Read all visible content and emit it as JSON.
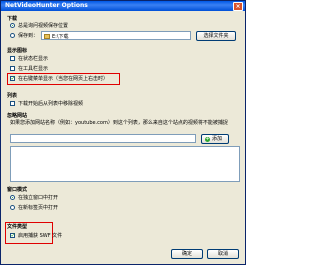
{
  "window": {
    "title": "NetVideoHunter Options",
    "close_glyph": "×"
  },
  "download": {
    "section_title": "下载",
    "ask_radio": "总是询问视频保存位置",
    "save_to_radio": "保存到：",
    "save_path": "E:\\下载",
    "choose_folder_button": "选择文件夹"
  },
  "display_icon": {
    "section_title": "显示图标",
    "option_statusbar": "在状态栏显示",
    "option_toolbar": "在工具栏显示",
    "option_context_menu": "在右键菜单显示（当您在网页上右击时）"
  },
  "list": {
    "section_title": "列表",
    "option_remove_on_download": "下载开始后从列表中移除视频"
  },
  "blocked_sites": {
    "section_title": "忽略网站",
    "description": "如果您添加网站名称（例如：youtube.com）到这个列表，那么来自这个站点的视频将不能被捕捉",
    "input_value": "",
    "add_button": "添加"
  },
  "window_mode": {
    "section_title": "窗口模式",
    "option_new_window": "在独立窗口中打开",
    "option_new_tab": "在新标签页中打开"
  },
  "file_type": {
    "section_title": "文件类型",
    "option_swf": "启用捕获 SWF 文件"
  },
  "footer": {
    "ok_button": "确定",
    "cancel_button": "取消"
  },
  "colors": {
    "highlight": "#e00000",
    "check_green": "#21a121",
    "title_bar": "#0058e6"
  }
}
